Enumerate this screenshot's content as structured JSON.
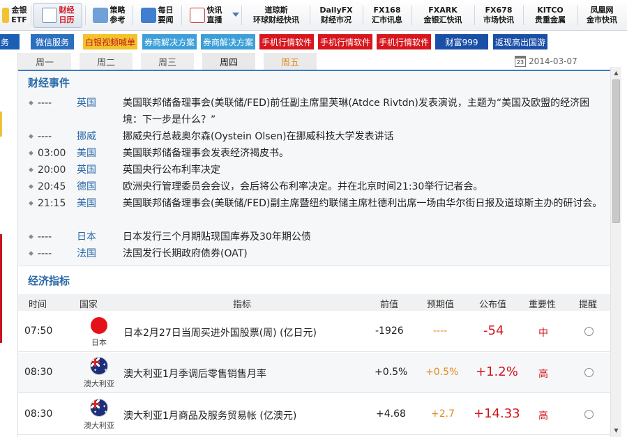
{
  "colors": {
    "accent_blue": "#2a6aa8",
    "red": "#d4121a",
    "orange": "#e08a1e"
  },
  "topnav": {
    "items": [
      {
        "l1": "金银",
        "l2": "ETF",
        "icon": "gold-etf-icon"
      },
      {
        "l1": "财经",
        "l2": "日历",
        "icon": "calendar-icon"
      },
      {
        "l1": "策略",
        "l2": "参考",
        "icon": "strategy-icon"
      },
      {
        "l1": "每日",
        "l2": "要闻",
        "icon": "news-icon"
      },
      {
        "l1": "快讯",
        "l2": "直播",
        "icon": "live-icon"
      },
      {
        "l1": "道琼斯",
        "l2": "环球财经快讯"
      },
      {
        "l1": "DailyFX",
        "l2": "财经市况"
      },
      {
        "l1": "FX168",
        "l2": "汇市讯息"
      },
      {
        "l1": "FXARK",
        "l2": "金银汇快讯"
      },
      {
        "l1": "FX678",
        "l2": "市场快讯"
      },
      {
        "l1": "KITCO",
        "l2": "贵重金属"
      },
      {
        "l1": "凤凰网",
        "l2": "金市快讯"
      }
    ]
  },
  "tagbar": {
    "tags": [
      "务",
      "微信服务",
      "白银视频喊单",
      "券商解决方案",
      "券商解决方案",
      "手机行情软件",
      "手机行情软件",
      "手机行情软件",
      "财富999",
      "返现高出国游"
    ]
  },
  "daytabs": {
    "days": [
      "周一",
      "周二",
      "周三",
      "周四",
      "周五"
    ],
    "date": "2014-03-07",
    "calendar_icon_text": "23"
  },
  "events": {
    "title": "财经事件",
    "items": [
      {
        "time": "----",
        "country": "英国",
        "text": "美国联邦储备理事会(美联储/FED)前任副主席里芙琳(Atdce Rivtdn)发表演说，主题为“美国及欧盟的经济困境：下一步是什么？”"
      },
      {
        "time": "----",
        "country": "挪威",
        "text": "挪威央行总裁奥尔森(Oystein Olsen)在挪威科技大学发表讲话"
      },
      {
        "time": "03:00",
        "country": "美国",
        "text": "美国联邦储备理事会发表经济褐皮书。"
      },
      {
        "time": "20:00",
        "country": "英国",
        "text": "英国央行公布利率决定"
      },
      {
        "time": "20:45",
        "country": "德国",
        "text": "欧洲央行管理委员会会议，会后将公布利率决定。并在北京时间21:30举行记者会。"
      },
      {
        "time": "21:15",
        "country": "美国",
        "text": "美国联邦储备理事会(美联储/FED)副主席暨纽约联储主席杜德利出席一场由华尔街日报及道琼斯主办的研讨会。"
      },
      {
        "time": "----",
        "country": "日本",
        "text": "日本发行三个月期贴现国库券及30年期公债"
      },
      {
        "time": "----",
        "country": "法国",
        "text": "法国发行长期政府债券(OAT)"
      }
    ]
  },
  "indicators": {
    "title": "经济指标",
    "columns": [
      "时间",
      "国家",
      "指标",
      "前值",
      "预期值",
      "公布值",
      "重要性",
      "提醒"
    ],
    "rows": [
      {
        "time": "07:50",
        "country": "日本",
        "name": "日本2月27日当周买进外国股票(周) (亿日元)",
        "prev": "-1926",
        "forecast": "----",
        "actual": "-54",
        "importance": "中"
      },
      {
        "time": "08:30",
        "country": "澳大利亚",
        "name": "澳大利亚1月季调后零售销售月率",
        "prev": "+0.5%",
        "forecast": "+0.5%",
        "actual": "+1.2%",
        "importance": "高"
      },
      {
        "time": "08:30",
        "country": "澳大利亚",
        "name": "澳大利亚1月商品及服务贸易帐 (亿澳元)",
        "prev": "+4.68",
        "forecast": "+2.7",
        "actual": "+14.33",
        "importance": "高"
      }
    ]
  }
}
